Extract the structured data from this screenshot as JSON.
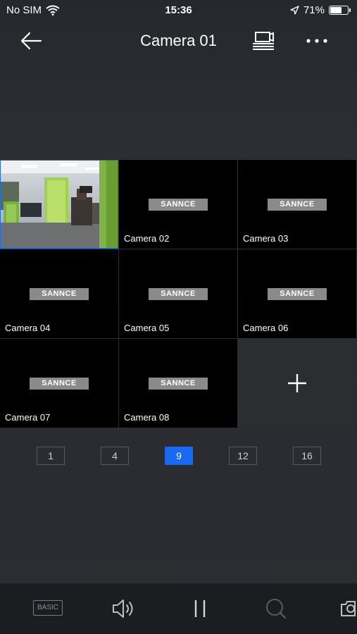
{
  "status": {
    "carrier": "No SIM",
    "time": "15:36",
    "battery_text": "71%",
    "battery_level": 0.71
  },
  "nav": {
    "title": "Camera 01",
    "back_icon": "arrow-left-icon",
    "switch_icon": "device-switch-icon",
    "more_icon": "more-dots-icon"
  },
  "grid": {
    "cells": [
      {
        "name": "",
        "selected": true,
        "type": "live-feed"
      },
      {
        "name": "Camera 02",
        "logo": "SANNCE"
      },
      {
        "name": "Camera 03",
        "logo": "SANNCE"
      },
      {
        "name": "Camera 04",
        "logo": "SANNCE"
      },
      {
        "name": "Camera 05",
        "logo": "SANNCE"
      },
      {
        "name": "Camera 06",
        "logo": "SANNCE"
      },
      {
        "name": "Camera 07",
        "logo": "SANNCE"
      },
      {
        "name": "Camera 08",
        "logo": "SANNCE"
      }
    ],
    "add_icon": "plus-icon"
  },
  "layouts": {
    "options": [
      "1",
      "4",
      "9",
      "12",
      "16"
    ],
    "active": "9"
  },
  "toolbar": {
    "basic_label": "BASIC",
    "speaker_icon": "speaker-icon",
    "pause_icon": "pause-icon",
    "zoom_icon": "search-icon",
    "snapshot_icon": "camera-icon"
  },
  "colors": {
    "accent": "#1669f0",
    "selected_border": "#1d6fe0",
    "toolbar_bg": "#1c1d21"
  }
}
